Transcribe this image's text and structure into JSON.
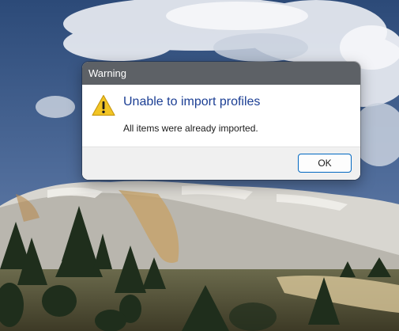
{
  "dialog": {
    "title": "Warning",
    "heading": "Unable to import profiles",
    "message": "All items were already imported.",
    "ok_label": "OK",
    "icon": "warning-icon"
  },
  "colors": {
    "titlebar": "#5d6166",
    "heading": "#1c3f94",
    "button_border": "#0067c0",
    "footer": "#f0f0f0",
    "warning_icon": "#f2c525"
  }
}
